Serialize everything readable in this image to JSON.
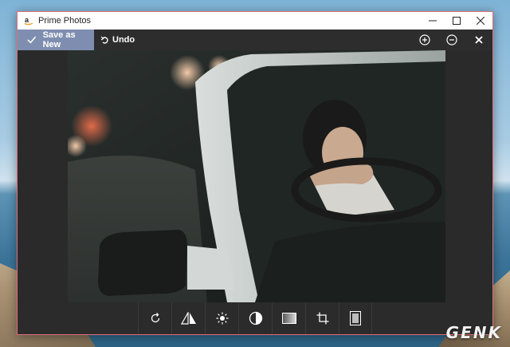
{
  "window": {
    "title": "Prime Photos",
    "border_color": "#e0707a"
  },
  "commandbar": {
    "save_label": "Save as New",
    "undo_label": "Undo",
    "save_bg": "#7f8eb0"
  },
  "controls": {
    "minimize_icon": "minimize-icon",
    "maximize_icon": "maximize-icon",
    "close_icon": "close-icon"
  },
  "header_actions": [
    "zoom-in-icon",
    "zoom-out-icon",
    "close-editor-icon"
  ],
  "tools": [
    "rotate-icon",
    "flip-icon",
    "brightness-icon",
    "contrast-icon",
    "filter-icon",
    "crop-icon",
    "frame-icon"
  ],
  "watermark": {
    "text": "GENK"
  }
}
